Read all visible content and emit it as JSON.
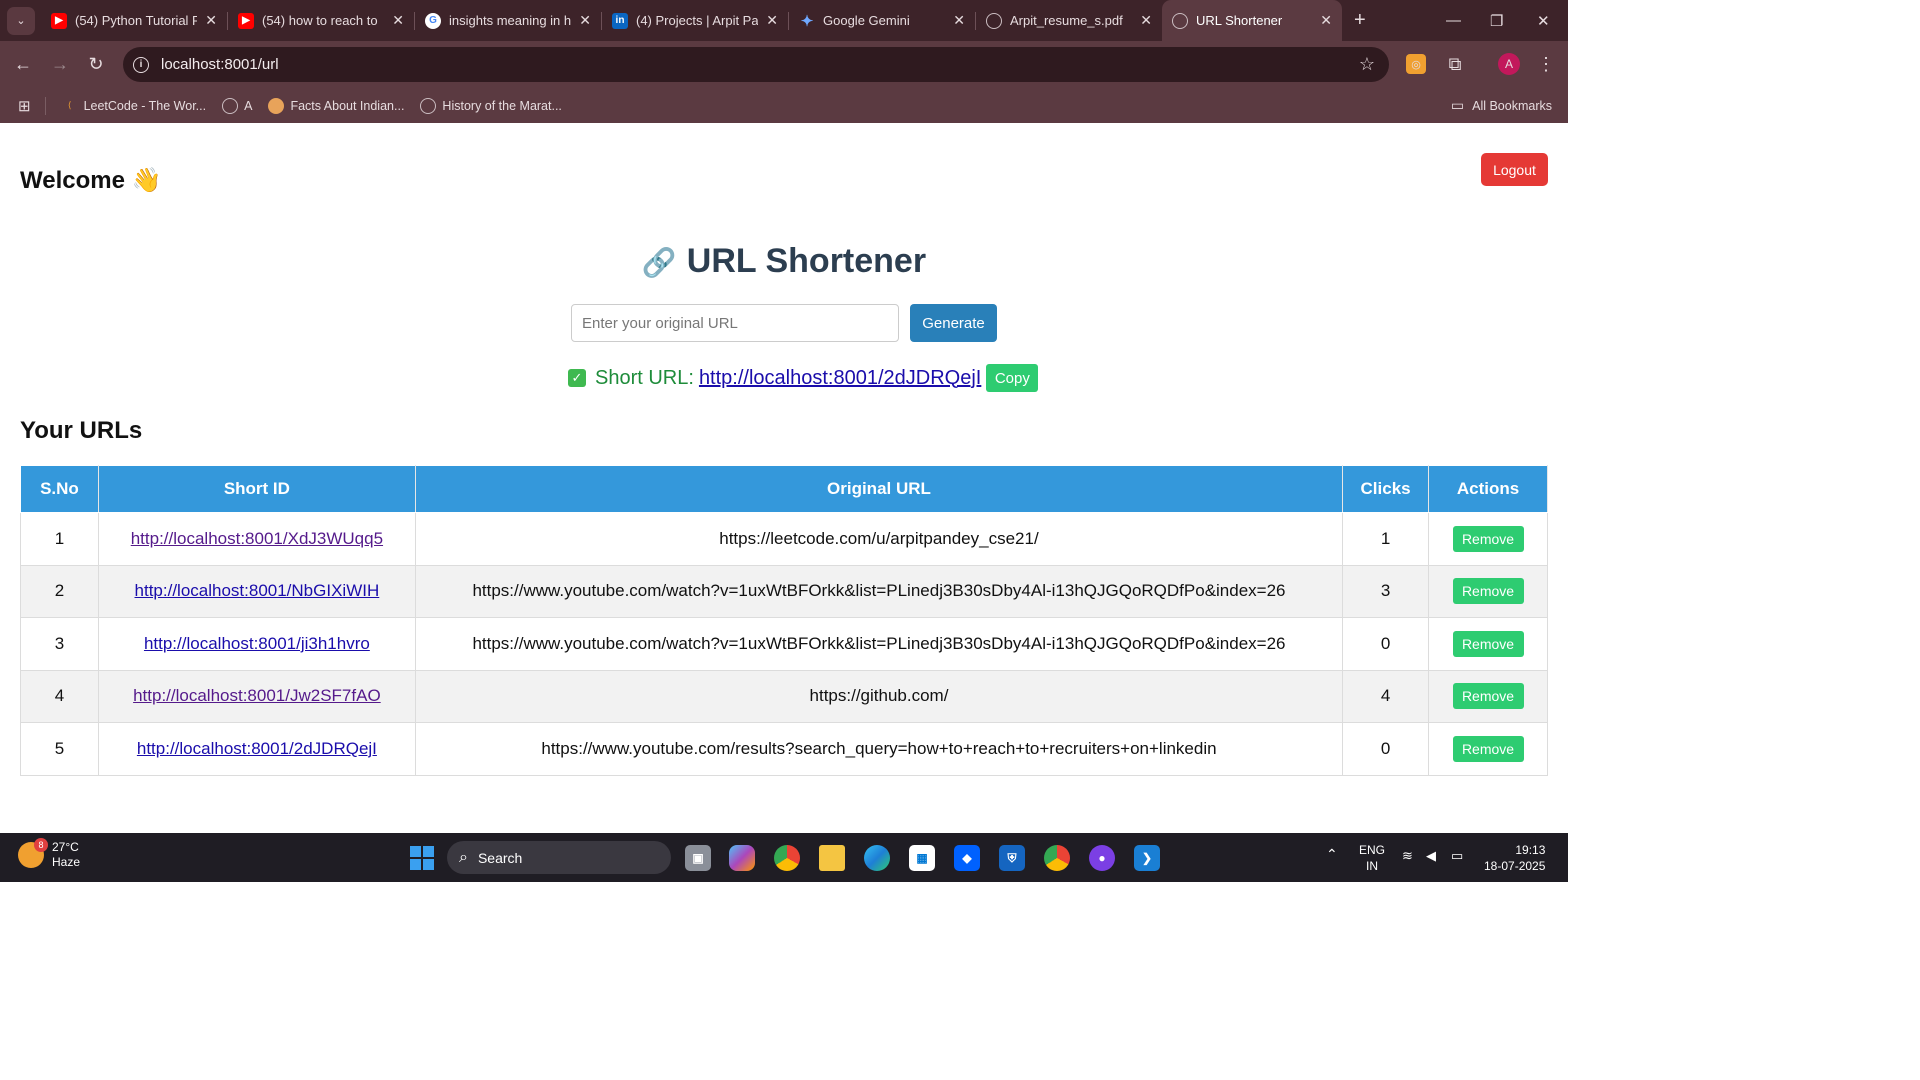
{
  "browser": {
    "tabs": [
      {
        "title": "(54) Python Tutorial F",
        "icon": "youtube-icon"
      },
      {
        "title": "(54) how to reach to",
        "icon": "youtube-icon"
      },
      {
        "title": "insights meaning in h",
        "icon": "google-icon"
      },
      {
        "title": "(4) Projects | Arpit Pa",
        "icon": "linkedin-icon"
      },
      {
        "title": "Google Gemini",
        "icon": "gemini-icon"
      },
      {
        "title": "Arpit_resume_s.pdf",
        "icon": "globe-icon"
      },
      {
        "title": "URL Shortener",
        "icon": "globe-icon",
        "active": true
      }
    ],
    "address": "localhost:8001/url",
    "bookmarks": [
      "LeetCode - The Wor...",
      "A",
      "Facts About Indian...",
      "History of the Marat..."
    ],
    "all_bookmarks_label": "All Bookmarks",
    "profile_initial": "A"
  },
  "page": {
    "welcome": "Welcome 👋",
    "logout_label": "Logout",
    "title_icon": "🔗",
    "title": "URL Shortener",
    "input_placeholder": "Enter your original URL",
    "generate_label": "Generate",
    "short_url_label": "Short URL:",
    "short_url_value": "http://localhost:8001/2dJDRQejI",
    "copy_label": "Copy",
    "list_heading": "Your URLs",
    "table": {
      "headers": [
        "S.No",
        "Short ID",
        "Original URL",
        "Clicks",
        "Actions"
      ],
      "rows": [
        {
          "sno": "1",
          "short": "http://localhost:8001/XdJ3WUqq5",
          "original": "https://leetcode.com/u/arpitpandey_cse21/",
          "clicks": "1",
          "action": "Remove"
        },
        {
          "sno": "2",
          "short": "http://localhost:8001/NbGIXiWIH",
          "original": "https://www.youtube.com/watch?v=1uxWtBFOrkk&list=PLinedj3B30sDby4Al-i13hQJGQoRQDfPo&index=26",
          "clicks": "3",
          "action": "Remove"
        },
        {
          "sno": "3",
          "short": "http://localhost:8001/ji3h1hvro",
          "original": "https://www.youtube.com/watch?v=1uxWtBFOrkk&list=PLinedj3B30sDby4Al-i13hQJGQoRQDfPo&index=26",
          "clicks": "0",
          "action": "Remove"
        },
        {
          "sno": "4",
          "short": "http://localhost:8001/Jw2SF7fAO",
          "original": "https://github.com/",
          "clicks": "4",
          "action": "Remove"
        },
        {
          "sno": "5",
          "short": "http://localhost:8001/2dJDRQejI",
          "original": "https://www.youtube.com/results?search_query=how+to+reach+to+recruiters+on+linkedin",
          "clicks": "0",
          "action": "Remove"
        }
      ]
    }
  },
  "taskbar": {
    "weather_badge": "8",
    "temperature": "27°C",
    "condition": "Haze",
    "search_label": "Search",
    "language_line1": "ENG",
    "language_line2": "IN",
    "time": "19:13",
    "date": "18-07-2025"
  },
  "colors": {
    "browser_frame": "#3d2329",
    "table_header": "#3498db",
    "generate_button": "#2980b9",
    "logout_button": "#e53935",
    "action_button": "#2ecc71"
  }
}
